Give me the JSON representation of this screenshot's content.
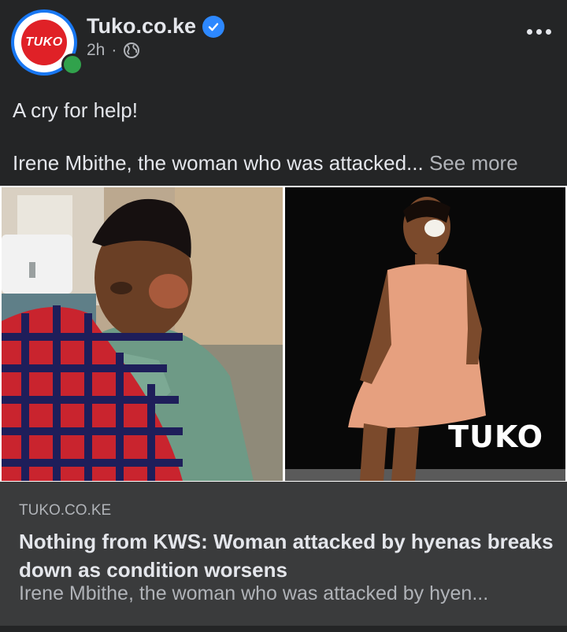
{
  "post": {
    "page_name": "Tuko.co.ke",
    "avatar_text": "TUKO",
    "time": "2h",
    "separator": "·",
    "line1": "A cry for help!",
    "line2": "Irene Mbithe, the woman who was attacked...",
    "see_more": "See more"
  },
  "images": {
    "watermark": "TUKO"
  },
  "link_preview": {
    "domain": "TUKO.CO.KE",
    "title": "Nothing from KWS: Woman attacked by hyenas breaks down as condition worsens",
    "description": "Irene Mbithe, the woman who was attacked by hyen..."
  },
  "icons": {
    "verified": "verified-badge-icon",
    "privacy": "globe-icon",
    "more": "more-options-icon"
  },
  "colors": {
    "background": "#242526",
    "card": "#3a3b3c",
    "accent": "#1877f2",
    "online": "#31a24c",
    "brand": "#e02127"
  }
}
